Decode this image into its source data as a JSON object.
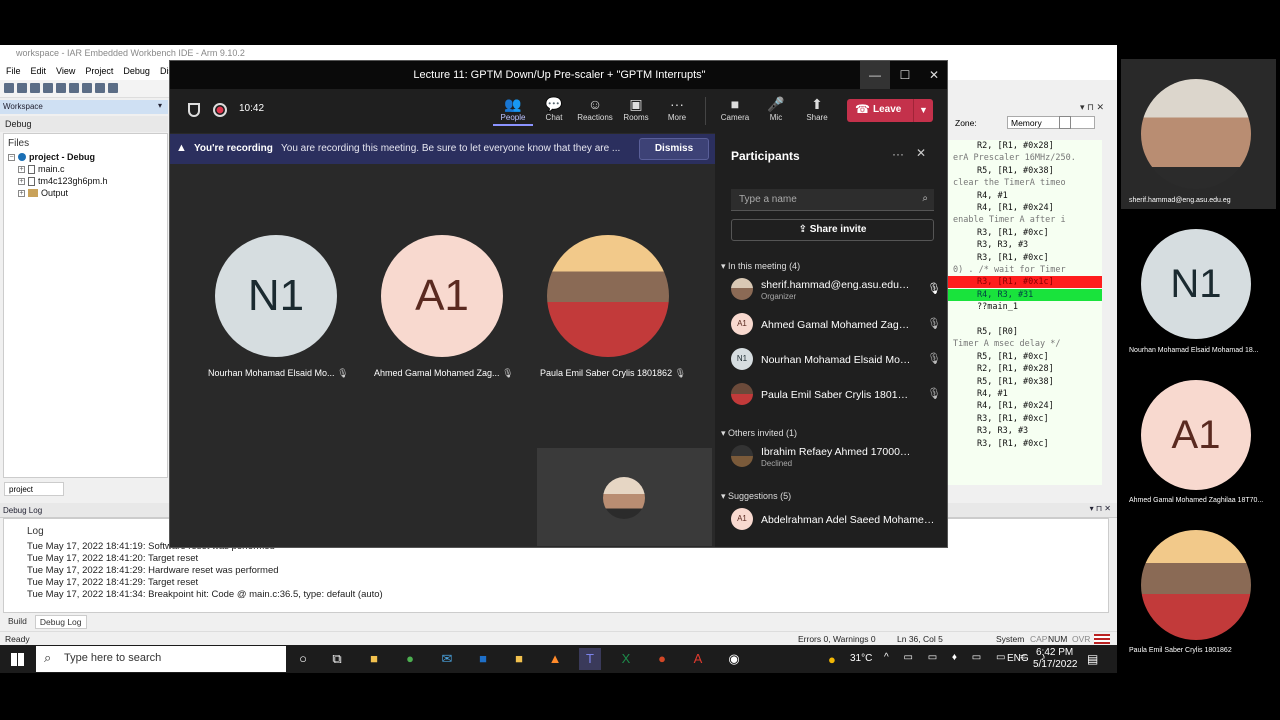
{
  "iar": {
    "title": "workspace - IAR Embedded Workbench IDE - Arm 9.10.2",
    "menu": [
      "File",
      "Edit",
      "View",
      "Project",
      "Debug",
      "Disa"
    ],
    "workspace_label": "Workspace",
    "workspace_config": "Debug",
    "files_header": "Files",
    "tree": [
      "project - Debug",
      "main.c",
      "tm4c123gh6pm.h",
      "Output"
    ],
    "project_tab": "project",
    "zone_label": "Zone:",
    "zone_value": "Memory",
    "debug_log_title": "Debug Log",
    "log_header": "Log",
    "log_lines": [
      "Tue May 17, 2022 18:41:19: Software reset was performed",
      "Tue May 17, 2022 18:41:20: Target reset",
      "Tue May 17, 2022 18:41:29: Hardware reset was performed",
      "Tue May 17, 2022 18:41:29: Target reset",
      "Tue May 17, 2022 18:41:34: Breakpoint hit: Code @ main.c:36.5, type: default (auto)"
    ],
    "bottom_tabs": [
      "Build",
      "Debug Log"
    ],
    "status": {
      "ready": "Ready",
      "errors": "Errors 0, Warnings 0",
      "position": "Ln 36, Col 5",
      "system": "System",
      "caps": "CAP",
      "num": "NUM",
      "ovr": "OVR"
    },
    "code_lines": [
      {
        "t": "R2, [R1, #0x28]",
        "k": "n"
      },
      {
        "t": "erA Prescaler 16MHz/250.",
        "k": "c"
      },
      {
        "t": "R5, [R1, #0x38]",
        "k": "n"
      },
      {
        "t": "clear the TimerA timeo",
        "k": "c"
      },
      {
        "t": "R4, #1",
        "k": "n"
      },
      {
        "t": "R4, [R1, #0x24]",
        "k": "n"
      },
      {
        "t": "enable Timer A after i",
        "k": "c"
      },
      {
        "t": "R3, [R1, #0xc]",
        "k": "n"
      },
      {
        "t": "R3, R3, #3",
        "k": "n"
      },
      {
        "t": "R3, [R1, #0xc]",
        "k": "n"
      },
      {
        "t": "0) . /* wait for Timer",
        "k": "c"
      },
      {
        "t": "R3, [R1, #0x1c]",
        "k": "r"
      },
      {
        "t": "R4, R3, #31",
        "k": "g"
      },
      {
        "t": "??main_1",
        "k": "n"
      },
      {
        "t": "",
        "k": "n"
      },
      {
        "t": "R5, [R0]",
        "k": "n"
      },
      {
        "t": "Timer A msec delay */",
        "k": "c"
      },
      {
        "t": "R5, [R1, #0xc]",
        "k": "n"
      },
      {
        "t": "R2, [R1, #0x28]",
        "k": "n"
      },
      {
        "t": "R5, [R1, #0x38]",
        "k": "n"
      },
      {
        "t": "R4, #1",
        "k": "n"
      },
      {
        "t": "R4, [R1, #0x24]",
        "k": "n"
      },
      {
        "t": "R3, [R1, #0xc]",
        "k": "n"
      },
      {
        "t": "R3, R3, #3",
        "k": "n"
      },
      {
        "t": "R3, [R1, #0xc]",
        "k": "n"
      }
    ]
  },
  "teams": {
    "title": "Lecture 11: GPTM Down/Up Pre-scaler + \"GPTM Interrupts\"",
    "timer": "10:42",
    "toolbar": [
      {
        "label": "People",
        "glyph": "👥"
      },
      {
        "label": "Chat",
        "glyph": "💬"
      },
      {
        "label": "Reactions",
        "glyph": "☺"
      },
      {
        "label": "Rooms",
        "glyph": "▣"
      },
      {
        "label": "More",
        "glyph": "···"
      },
      {
        "label": "Camera",
        "glyph": "■"
      },
      {
        "label": "Mic",
        "glyph": "🎤"
      },
      {
        "label": "Share",
        "glyph": "⬆"
      }
    ],
    "leave_label": "Leave",
    "recording": {
      "bold": "You're recording",
      "message": "You are recording this meeting. Be sure to let everyone know that they are ...",
      "dismiss": "Dismiss"
    },
    "tiles": [
      {
        "initials": "N1",
        "name": "Nourhan Mohamad Elsaid Mo...",
        "bg": "#d6dde0",
        "fg": "#1b2a30"
      },
      {
        "initials": "A1",
        "name": "Ahmed Gamal Mohamed Zag...",
        "bg": "#f8d9cf",
        "fg": "#5a2a20"
      },
      {
        "initials": "",
        "name": "Paula Emil Saber Crylis 1801862",
        "bg": "#8a6a55",
        "fg": "#fff"
      }
    ],
    "participants": {
      "title": "Participants",
      "search_placeholder": "Type a name",
      "share_invite": "Share invite",
      "in_meeting": "In this meeting (4)",
      "others_invited": "Others invited (1)",
      "suggestions": "Suggestions (5)",
      "members": [
        {
          "av": "",
          "name": "sherif.hammad@eng.asu.edu.eg",
          "sub": "Organizer"
        },
        {
          "av": "A1",
          "name": "Ahmed Gamal Mohamed Zaghil...",
          "sub": ""
        },
        {
          "av": "N1",
          "name": "Nourhan Mohamad Elsaid Moha...",
          "sub": ""
        },
        {
          "av": "",
          "name": "Paula Emil Saber Crylis 1801862",
          "sub": ""
        }
      ],
      "invited": [
        {
          "av": "",
          "name": "Ibrahim Refaey Ahmed 1700014",
          "sub": "Declined"
        }
      ],
      "suggested": [
        {
          "av": "A1",
          "name": "Abdelrahman Adel Saeed Mohamed...",
          "sub": ""
        }
      ]
    }
  },
  "gallery": [
    {
      "initials": "",
      "name": "sherif.hammad@eng.asu.edu.eg"
    },
    {
      "initials": "N1",
      "name": "Nourhan Mohamad Elsaid Mohamad 18..."
    },
    {
      "initials": "A1",
      "name": "Ahmed Gamal Mohamed Zaghilaa 18T70..."
    },
    {
      "initials": "",
      "name": "Paula Emil Saber Crylis 1801862"
    }
  ],
  "taskbar": {
    "search_placeholder": "Type here to search",
    "temperature": "31°C",
    "lang": "ENG",
    "time": "6:42 PM",
    "date": "5/17/2022"
  }
}
